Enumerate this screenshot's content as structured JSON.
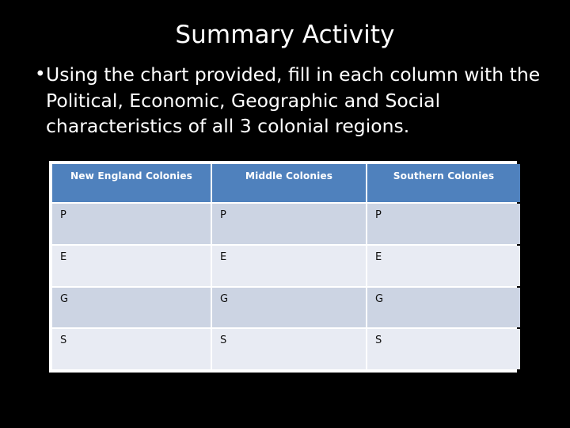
{
  "slide": {
    "background_color": "#000000",
    "text_color": "#ffffff",
    "title": "Summary Activity",
    "bullets": [
      {
        "marker": "•",
        "text": "Using the chart provided, fill in each column with the Political, Economic, Geographic and Social characteristics of all 3 colonial regions."
      }
    ]
  },
  "table": {
    "header_color": "#4f81bd",
    "band_dark_color": "#ccd4e3",
    "band_light_color": "#e8ebf3",
    "border_color": "#ffffff",
    "columns": [
      "New England Colonies",
      "Middle Colonies",
      "Southern Colonies"
    ],
    "rows": [
      {
        "band": "dark",
        "cells": [
          "P",
          "P",
          "P"
        ]
      },
      {
        "band": "light",
        "cells": [
          "E",
          "E",
          "E"
        ]
      },
      {
        "band": "dark",
        "cells": [
          "G",
          "G",
          "G"
        ]
      },
      {
        "band": "light",
        "cells": [
          "S",
          "S",
          "S"
        ]
      }
    ]
  }
}
